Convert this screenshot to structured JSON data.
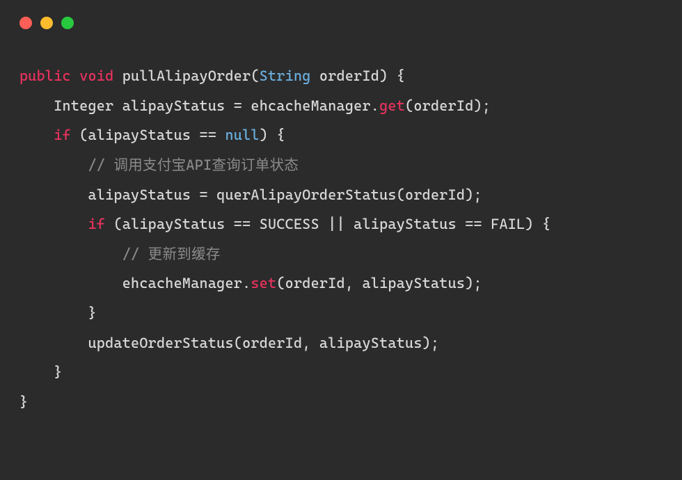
{
  "colors": {
    "red": "#ff5f56",
    "yellow": "#ffbd2e",
    "green": "#27c93f",
    "bg": "#2b2b2b"
  },
  "code": {
    "l1": {
      "mod1": "public",
      "mod2": "void",
      "fn": " pullAlipayOrder(",
      "type": "String",
      "rest": " orderId) {"
    },
    "l2": "    Integer alipayStatus = ehcacheManager.",
    "l2_get": "get",
    "l2_end": "(orderId);",
    "l3_if": "    if",
    "l3_mid": " (alipayStatus == ",
    "l3_null": "null",
    "l3_end": ") {",
    "l4": "        // 调用支付宝API查询订单状态",
    "l5": "        alipayStatus = querAlipayOrderStatus(orderId);",
    "l6_if": "        if",
    "l6_rest": " (alipayStatus == SUCCESS || alipayStatus == FAIL) {",
    "l7": "            // 更新到缓存",
    "l8_a": "            ehcacheManager.",
    "l8_set": "set",
    "l8_b": "(orderId, alipayStatus);",
    "l9": "        }",
    "l10": "        updateOrderStatus(orderId, alipayStatus);",
    "l11": "    }",
    "l12": "}"
  }
}
